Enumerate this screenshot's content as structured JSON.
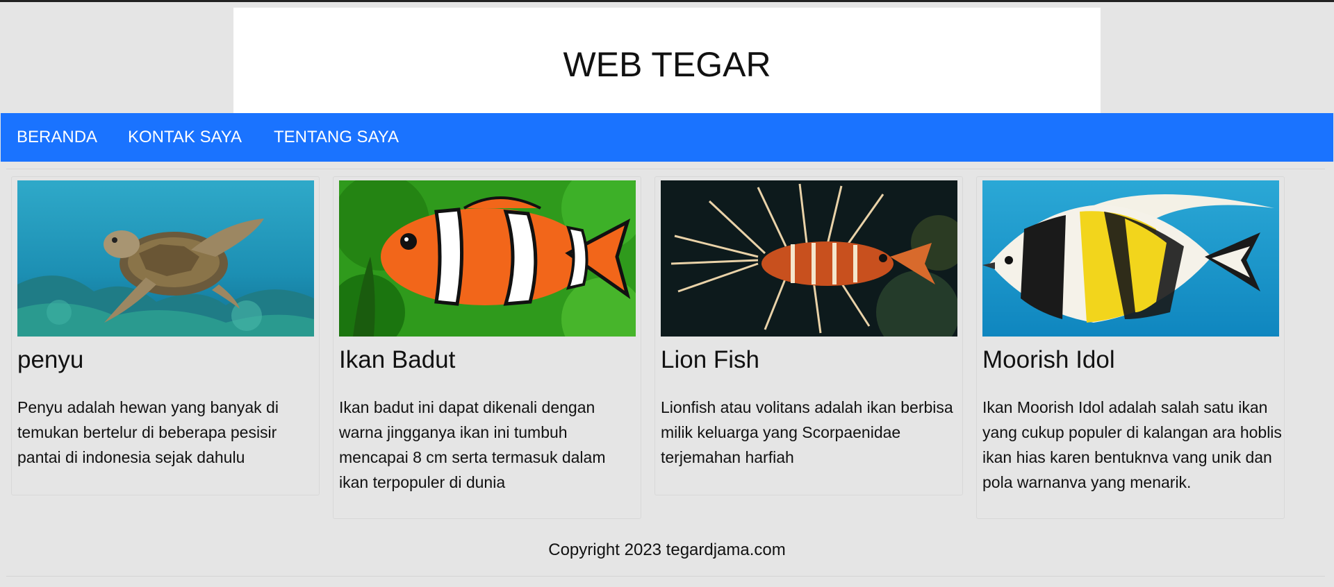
{
  "site": {
    "title": "WEB TEGAR"
  },
  "nav": {
    "items": [
      {
        "label": "BERANDA"
      },
      {
        "label": "KONTAK SAYA"
      },
      {
        "label": "TENTANG SAYA"
      }
    ]
  },
  "cards": [
    {
      "image": "sea-turtle-photo",
      "title": "penyu",
      "text": "Penyu adalah hewan yang banyak di temukan bertelur di beberapa pesisir pantai di indonesia sejak dahulu"
    },
    {
      "image": "clownfish-photo",
      "title": "Ikan Badut",
      "text": "Ikan badut ini dapat dikenali dengan warna jingganya ikan ini tumbuh mencapai 8 cm serta termasuk dalam ikan terpopuler di dunia"
    },
    {
      "image": "lionfish-photo",
      "title": "Lion Fish",
      "text": "Lionfish atau volitans adalah ikan berbisa milik keluarga yang Scorpaenidae terjemahan harfiah"
    },
    {
      "image": "moorish-idol-photo",
      "title": "Moorish Idol",
      "text": "Ikan Moorish Idol adalah salah satu ikan yang cukup populer di kalangan ara hoblis ikan hias karen bentuknva vang unik dan pola warnanva yang menarik."
    }
  ],
  "footer": {
    "copyright": "Copyright 2023 tegardjama.com"
  },
  "colors": {
    "nav_bg": "#1a73ff",
    "page_bg": "#e5e5e5",
    "header_bg": "#ffffff"
  }
}
